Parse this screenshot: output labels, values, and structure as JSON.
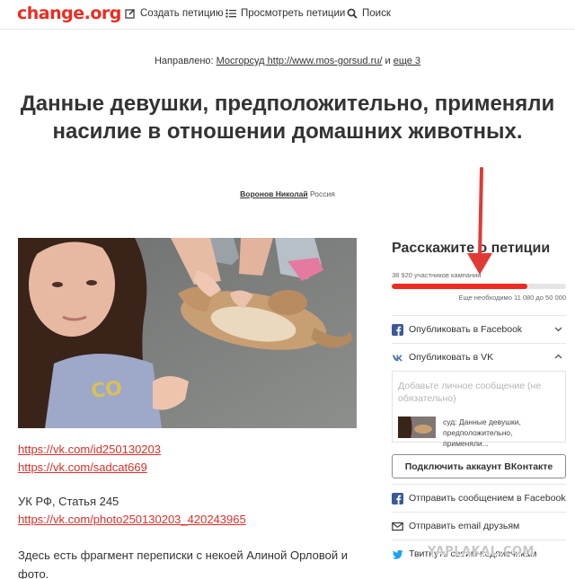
{
  "header": {
    "logo": "change.org",
    "nav": {
      "create": "Создать петицию",
      "browse": "Просмотреть петиции",
      "search": "Поиск"
    }
  },
  "targeted": {
    "prefix": "Направлено:",
    "target": "Мосгорсуд http://www.mos-gorsud.ru/",
    "sep": "и",
    "more": "еще 3"
  },
  "petition": {
    "title": "Данные девушки, предположительно, применяли насилие в отношении домашних животных.",
    "author_name": "Воронов Николай",
    "author_location": "Россия"
  },
  "body": {
    "links": [
      "https://vk.com/id250130203",
      "https://vk.com/sadcat669"
    ],
    "law_text": "УК РФ, Статья 245",
    "law_link": "https://vk.com/photo250130203_420243965",
    "paragraph": "Здесь есть фрагмент переписки с некоей Алиной Орловой и фото."
  },
  "sidebar": {
    "title": "Расскажите о петиции",
    "signatures": "38 920 участников кампании",
    "progress_fraction": 0.78,
    "needed": "Еще необходимо 11 080 до 50 000",
    "share_facebook": "Опубликовать в Facebook",
    "share_vk": "Опубликовать в VK",
    "vk_placeholder": "Добавьте личное сообщение (не обязательно)",
    "vk_snippet": "суд: Данные девушки, предположительно, применяли...",
    "vk_connect": "Подключить аккаунт ВКонтакте",
    "fb_message": "Отправить сообщением в Facebook",
    "email": "Отправить email друзьям",
    "twitter": "Твитнуть своим подписчикам"
  },
  "watermark": "YAPLAKAL.COM",
  "colors": {
    "brand": "#ec2c22",
    "facebook": "#3b5998",
    "vk": "#4a76a8",
    "twitter": "#1da1f2",
    "arrow": "#e03a36"
  },
  "icons": {
    "create": "pencil-box-icon",
    "browse": "list-icon",
    "search": "search-icon",
    "facebook": "facebook-icon",
    "vk": "vk-icon",
    "messenger": "facebook-icon",
    "email": "envelope-icon",
    "twitter": "twitter-bird-icon"
  }
}
